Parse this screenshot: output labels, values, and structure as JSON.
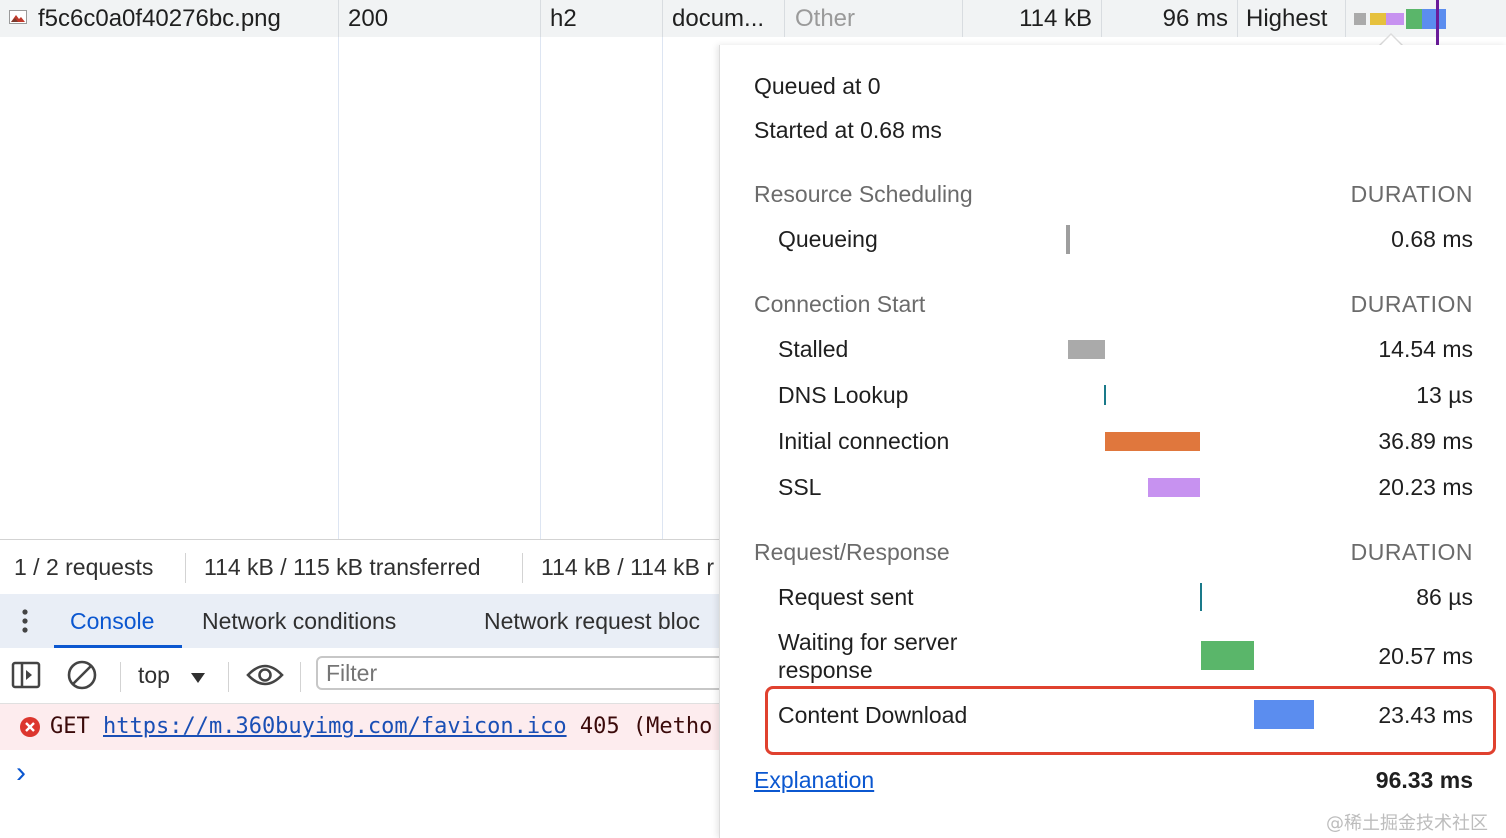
{
  "network_row": {
    "name": "f5c6c0a0f40276bc.png",
    "status": "200",
    "protocol": "h2",
    "type": "docum...",
    "initiator": "Other",
    "size": "114 kB",
    "time": "96 ms",
    "priority": "Highest"
  },
  "status_bar": {
    "requests": "1 / 2 requests",
    "transferred": "114 kB / 115 kB transferred",
    "resources": "114 kB / 114 kB r"
  },
  "drawer": {
    "tabs": [
      "Console",
      "Network conditions",
      "Network request bloc"
    ],
    "active_tab": "Console"
  },
  "console": {
    "context": "top",
    "filter_placeholder": "Filter",
    "error": {
      "method": "GET",
      "url": "https://m.360buyimg.com/favicon.ico",
      "code": "405",
      "rest": "(Metho"
    },
    "prompt": "›"
  },
  "timing": {
    "queued_at": "Queued at 0",
    "started_at": "Started at 0.68 ms",
    "duration_header": "DURATION",
    "sections": {
      "resource_scheduling": {
        "title": "Resource Scheduling",
        "rows": [
          {
            "label": "Queueing",
            "value": "0.68 ms",
            "color": "#9e9e9e"
          }
        ]
      },
      "connection_start": {
        "title": "Connection Start",
        "rows": [
          {
            "label": "Stalled",
            "value": "14.54 ms",
            "color": "#aaaaaa"
          },
          {
            "label": "DNS Lookup",
            "value": "13 µs",
            "color": "#1a7a8a"
          },
          {
            "label": "Initial connection",
            "value": "36.89 ms",
            "color": "#e0773d"
          },
          {
            "label": "SSL",
            "value": "20.23 ms",
            "color": "#c792f0"
          }
        ]
      },
      "request_response": {
        "title": "Request/Response",
        "rows": [
          {
            "label": "Request sent",
            "value": "86 µs",
            "color": "#1a7a8a"
          },
          {
            "label": "Waiting for server",
            "label2": "response",
            "value": "20.57 ms",
            "color": "#5ab66a"
          },
          {
            "label": "Content Download",
            "value": "23.43 ms",
            "color": "#5b8def"
          }
        ]
      }
    },
    "explanation": "Explanation",
    "total": "96.33 ms"
  },
  "watermark": "@稀土掘金技术社区"
}
